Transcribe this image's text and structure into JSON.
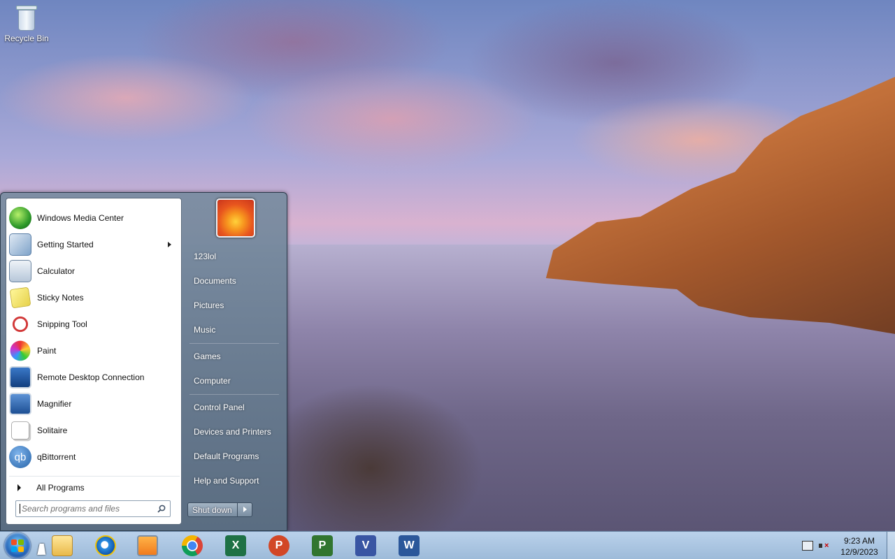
{
  "desktop": {
    "icons": [
      {
        "label": "Recycle Bin",
        "icon": "recycle-bin-icon"
      }
    ]
  },
  "start_menu": {
    "programs": [
      {
        "label": "Windows Media Center",
        "icon": "windows-media-center-icon",
        "has_submenu": false
      },
      {
        "label": "Getting Started",
        "icon": "getting-started-icon",
        "has_submenu": true
      },
      {
        "label": "Calculator",
        "icon": "calculator-icon",
        "has_submenu": false
      },
      {
        "label": "Sticky Notes",
        "icon": "sticky-notes-icon",
        "has_submenu": false
      },
      {
        "label": "Snipping Tool",
        "icon": "snipping-tool-icon",
        "has_submenu": false
      },
      {
        "label": "Paint",
        "icon": "paint-icon",
        "has_submenu": false
      },
      {
        "label": "Remote Desktop Connection",
        "icon": "remote-desktop-icon",
        "has_submenu": false
      },
      {
        "label": "Magnifier",
        "icon": "magnifier-icon",
        "has_submenu": false
      },
      {
        "label": "Solitaire",
        "icon": "solitaire-icon",
        "has_submenu": false
      },
      {
        "label": "qBittorrent",
        "icon": "qbittorrent-icon",
        "has_submenu": false
      }
    ],
    "all_programs_label": "All Programs",
    "search_placeholder": "Search programs and files",
    "right_items": [
      "123lol",
      "Documents",
      "Pictures",
      "Music",
      "Games",
      "Computer",
      "Control Panel",
      "Devices and Printers",
      "Default Programs",
      "Help and Support"
    ],
    "shutdown_label": "Shut down"
  },
  "taskbar": {
    "pinned": [
      {
        "name": "file-explorer",
        "icon": "folder-icon"
      },
      {
        "name": "internet-explorer",
        "icon": "internet-explorer-icon"
      },
      {
        "name": "media-player",
        "icon": "media-player-icon"
      },
      {
        "name": "chrome",
        "icon": "chrome-icon"
      },
      {
        "name": "excel",
        "icon": "excel-icon",
        "letter": "X"
      },
      {
        "name": "powerpoint",
        "icon": "powerpoint-icon",
        "letter": "P"
      },
      {
        "name": "project",
        "icon": "project-icon",
        "letter": "P"
      },
      {
        "name": "visio",
        "icon": "visio-icon",
        "letter": "V"
      },
      {
        "name": "word",
        "icon": "word-icon",
        "letter": "W"
      }
    ],
    "clock": {
      "time": "9:23 AM",
      "date": "12/9/2023"
    }
  },
  "colors": {
    "taskbar": "#a8c4e2",
    "start_menu_frame": "#6f8aa3",
    "excel": "#1e7145",
    "powerpoint": "#d24726",
    "project": "#31752f",
    "visio": "#3955a3",
    "word": "#2b579a"
  }
}
